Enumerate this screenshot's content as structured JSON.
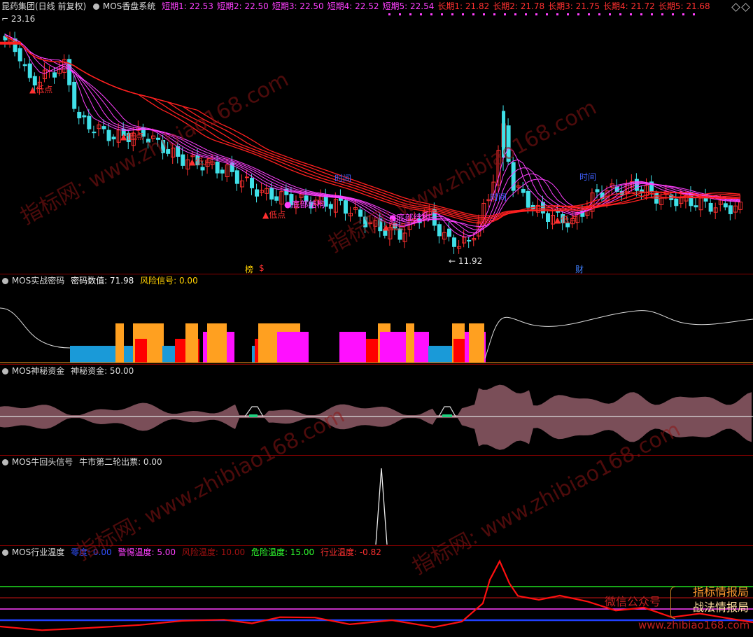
{
  "main": {
    "stock_name": "昆药集团(日线 前复权)",
    "indicator_name": "MOS香盘系统",
    "ma_labels": [
      {
        "text": "短期1: 22.53",
        "color": "#ff40ff"
      },
      {
        "text": "短期2: 22.50",
        "color": "#ff40ff"
      },
      {
        "text": "短期3: 22.50",
        "color": "#ff40ff"
      },
      {
        "text": "短期4: 22.52",
        "color": "#ff40ff"
      },
      {
        "text": "短期5: 22.54",
        "color": "#ff40ff"
      },
      {
        "text": "长期1: 21.82",
        "color": "#ff3030"
      },
      {
        "text": "长期2: 21.78",
        "color": "#ff3030"
      },
      {
        "text": "长期3: 21.75",
        "color": "#ff3030"
      },
      {
        "text": "长期4: 21.72",
        "color": "#ff3030"
      },
      {
        "text": "长期5: 21.68",
        "color": "#ff3030"
      }
    ],
    "high_price": "23.16",
    "low_price": "11.92",
    "annotations": {
      "low_point": "▲低点",
      "bottom_structure": "●底部结构",
      "time_label": "时间",
      "financial_label": "财",
      "bang_label": "榜",
      "dollar_label": "$"
    }
  },
  "panel_code": {
    "name": "MOS实战密码",
    "value_text": "密码数值: 71.98",
    "risk_text": "风险信号: 0.00"
  },
  "panel_fund": {
    "name": "MOS神秘资金",
    "value_text": "神秘资金: 50.00"
  },
  "panel_bull": {
    "name": "MOS牛回头信号",
    "value_text": "牛市第二轮出票: 0.00"
  },
  "panel_temp": {
    "name": "MOS行业温度",
    "zero": "零度: 0.00",
    "alert": "警惕温度: 5.00",
    "risk": "风险温度: 10.00",
    "danger": "危险温度: 15.00",
    "industry": "行业温度: -0.82"
  },
  "watermarks": [
    "指标网: www.zhibiao168.com",
    "指标网: www.zhibiao168.com",
    "指标网: www.zhibiao168.com",
    "指标网: www.zhibiao168.com"
  ],
  "wechat": {
    "label": "微信公众号",
    "line1": "指标情报局",
    "line2": "战法情报局",
    "url": "www.zhibiao168.com"
  },
  "colors": {
    "up": "#ff3030",
    "down": "#40e0e8",
    "short_ma": "#ff40ff",
    "long_ma": "#ff2020",
    "orange": "#ffa020",
    "cyan_bar": "#1a9ad8",
    "magenta_bar": "#ff10ff",
    "red_bar": "#ff0000",
    "fund_fill": "#7a4e58"
  }
}
